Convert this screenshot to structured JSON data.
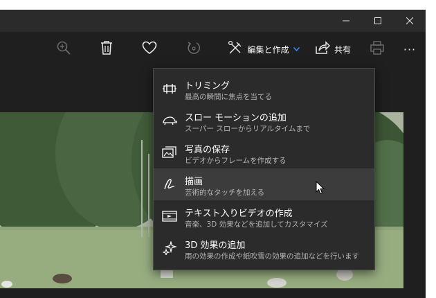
{
  "titlebar": {
    "minimize_icon": "minimize-icon",
    "maximize_icon": "maximize-icon",
    "close_icon": "close-icon"
  },
  "toolbar": {
    "zoom_icon": "zoom-in-icon",
    "delete_icon": "trash-icon",
    "favorite_icon": "heart-icon",
    "rotate_icon": "rotate-icon",
    "edit_label": "編集と作成",
    "share_label": "共有",
    "print_icon": "printer-icon",
    "more_label": "···"
  },
  "menu": {
    "items": [
      {
        "title": "トリミング",
        "subtitle": "最高の瞬間に焦点を当てる",
        "icon": "trim-icon"
      },
      {
        "title": "スロー モーションの追加",
        "subtitle": "スーパー スローからリアルタイムまで",
        "icon": "turtle-icon"
      },
      {
        "title": "写真の保存",
        "subtitle": "ビデオからフレームを作成する",
        "icon": "save-photo-icon"
      },
      {
        "title": "描画",
        "subtitle": "芸術的なタッチを加える",
        "icon": "pen-icon"
      },
      {
        "title": "テキスト入りビデオの作成",
        "subtitle": "音楽、3D 効果などを追加してカスタマイズ",
        "icon": "video-text-icon"
      },
      {
        "title": "3D 効果の追加",
        "subtitle": "雨の効果の作成や紙吹雪の効果の追加などを行います",
        "icon": "sparkle-icon"
      }
    ]
  },
  "colors": {
    "accent": "#2f8fff",
    "background": "#1f1f1f",
    "menu_background": "#2b2b2b",
    "menu_hover": "#3c3c3c"
  }
}
